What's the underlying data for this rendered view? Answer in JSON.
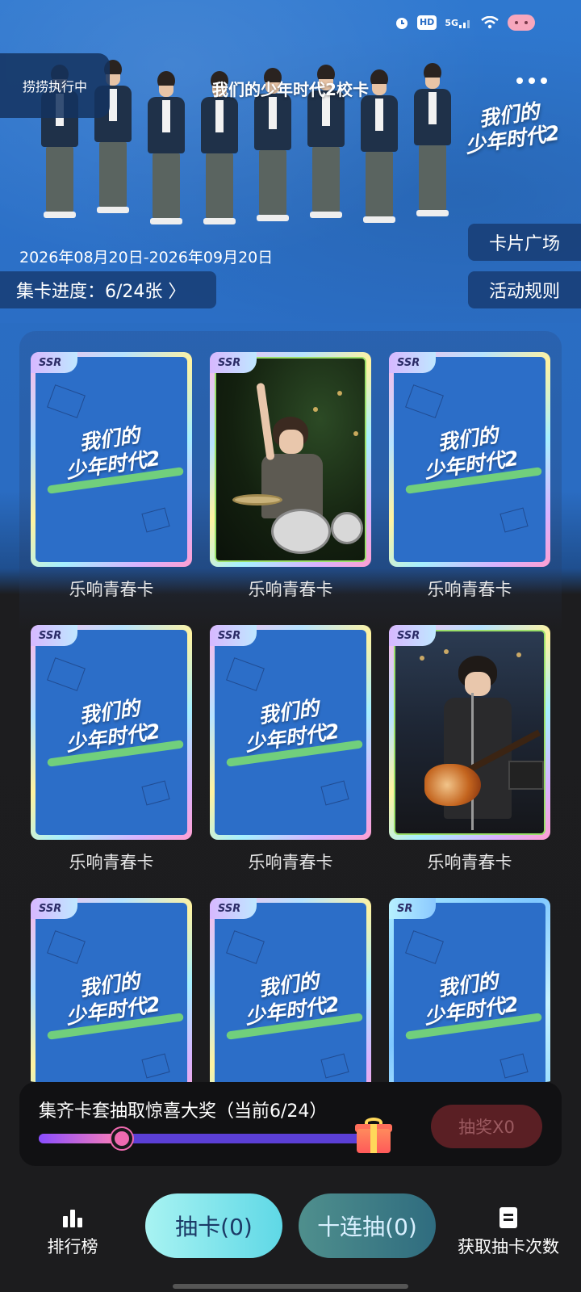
{
  "status_bar": {
    "icons": [
      "alarm-icon",
      "hd-icon",
      "5g-signal-icon",
      "wifi-icon",
      "pig-icon"
    ],
    "hd_label": "HD",
    "network_label": "5G"
  },
  "floating_pill": {
    "label": "捞捞执行中"
  },
  "header": {
    "title": "我们的少年时代2校卡",
    "logo_text_line1": "我们的",
    "logo_text_line2": "少年时代2"
  },
  "event": {
    "date_range": "2026年08月20日-2026年09月20日",
    "progress_label": "集卡进度：6/24张 〉",
    "card_plaza_label": "卡片广场",
    "rules_label": "活动规则"
  },
  "cards": [
    {
      "rarity": "SSR",
      "label": "乐响青春卡",
      "state": "locked"
    },
    {
      "rarity": "SSR",
      "label": "乐响青春卡",
      "state": "owned-drums"
    },
    {
      "rarity": "SSR",
      "label": "乐响青春卡",
      "state": "locked"
    },
    {
      "rarity": "SSR",
      "label": "乐响青春卡",
      "state": "locked"
    },
    {
      "rarity": "SSR",
      "label": "乐响青春卡",
      "state": "locked"
    },
    {
      "rarity": "SSR",
      "label": "乐响青春卡",
      "state": "owned-guitar"
    },
    {
      "rarity": "SSR",
      "label": "",
      "state": "locked"
    },
    {
      "rarity": "SSR",
      "label": "",
      "state": "locked"
    },
    {
      "rarity": "SR",
      "label": "",
      "state": "locked"
    }
  ],
  "card_cover": {
    "line1": "我们的",
    "line2": "少年时代2"
  },
  "reward": {
    "text": "集齐卡套抽取惊喜大奖（当前6/24）",
    "progress": 0.25,
    "lottery_label": "抽奖X0"
  },
  "bottom_nav": {
    "ranking_label": "排行榜",
    "draw_one_label": "抽卡(0)",
    "draw_ten_label": "十连抽(0)",
    "get_chances_label": "获取抽卡次数"
  },
  "colors": {
    "hero_blue": "#2b6ec5",
    "panel_dark": "#111113",
    "lottery_disabled": "#5a1f24",
    "progress_start": "#8a4dff",
    "progress_end": "#ff80b5"
  }
}
